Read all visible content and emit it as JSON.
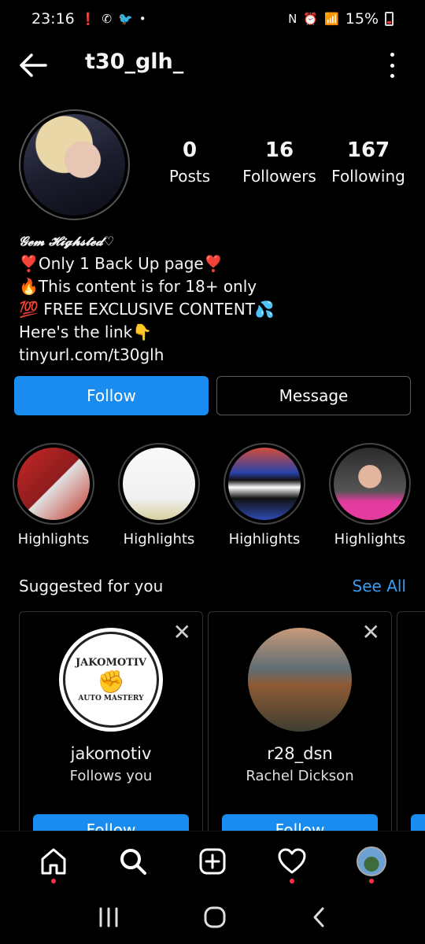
{
  "status_bar": {
    "time": "23:16",
    "left_icons": [
      "alert-icon",
      "whatsapp-icon",
      "twitter-icon",
      "dot-icon"
    ],
    "right_icons": [
      "nfc-icon",
      "alarm-icon",
      "wifi-icon",
      "signal-icon"
    ],
    "battery": "15%"
  },
  "header": {
    "username": "t30_glh_"
  },
  "profile": {
    "stats": [
      {
        "value": "0",
        "label": "Posts"
      },
      {
        "value": "16",
        "label": "Followers"
      },
      {
        "value": "167",
        "label": "Following"
      }
    ],
    "bio": {
      "name": "𝓖𝓮𝓶 𝓗𝓲𝓰𝓱𝓼𝓽𝓮𝓭♡",
      "lines": [
        "❣️Only 1 Back Up  page❣️",
        "🔥This content is for 18+ only",
        "💯 FREE EXCLUSIVE CONTENT💦",
        "Here's the link👇",
        "tinyurl.com/t30glh"
      ]
    },
    "follow_label": "Follow",
    "message_label": "Message"
  },
  "highlights": [
    {
      "label": "Highlights"
    },
    {
      "label": "Highlights"
    },
    {
      "label": "Highlights"
    },
    {
      "label": "Highlights"
    }
  ],
  "suggested": {
    "title": "Suggested for you",
    "see_all": "See All",
    "cards": [
      {
        "username": "jakomotiv",
        "subtitle": "Follows you",
        "button": "Follow",
        "logo_top": "JAKOMOTIV",
        "logo_bottom": "AUTO MASTERY"
      },
      {
        "username": "r28_dsn",
        "subtitle": "Rachel Dickson",
        "button": "Follow"
      }
    ]
  },
  "bottom_nav": [
    "home-icon",
    "search-icon",
    "create-icon",
    "heart-icon",
    "profile-avatar"
  ],
  "colors": {
    "accent": "#1a8cf0",
    "link": "#3a9bf0",
    "background": "#000000",
    "notification_dot": "#ff3040"
  }
}
